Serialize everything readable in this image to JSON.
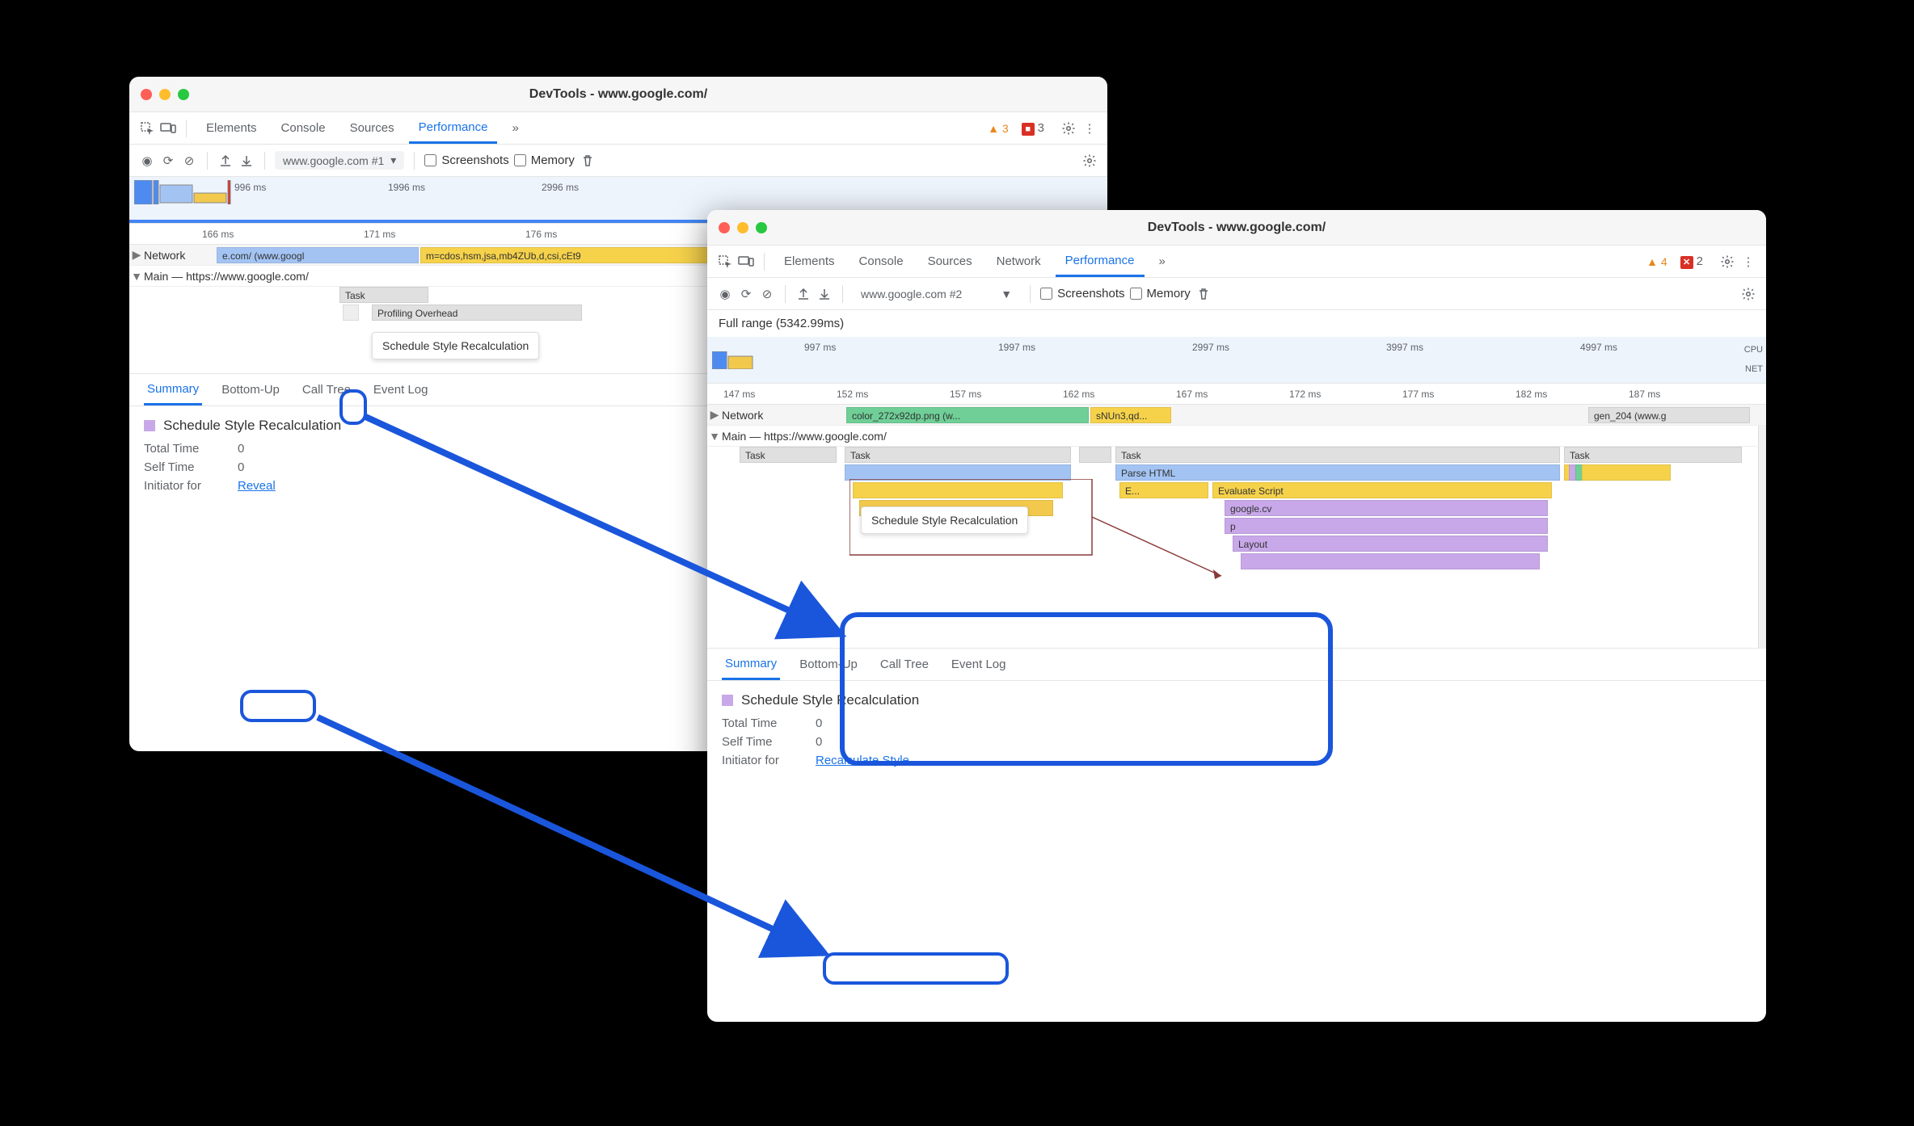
{
  "win1": {
    "title": "DevTools - www.google.com/",
    "tabs": {
      "elements": "Elements",
      "console": "Console",
      "sources": "Sources",
      "performance": "Performance",
      "more": "»"
    },
    "warn_count": "3",
    "err_count": "3",
    "toolbar": {
      "url": "www.google.com #1",
      "screenshots": "Screenshots",
      "memory": "Memory"
    },
    "timeline": {
      "t0": "996 ms",
      "t1": "1996 ms",
      "t2": "2996 ms"
    },
    "ruler": {
      "r0": "166 ms",
      "r1": "171 ms",
      "r2": "176 ms"
    },
    "network_label": "Network",
    "network_spans": {
      "a": "e.com/ (www.googl",
      "b": "m=cdos,hsm,jsa,mb4ZUb,d,csi,cEt9"
    },
    "main_label": "Main — https://www.google.com/",
    "flame": {
      "task": "Task",
      "profiling": "Profiling Overhead",
      "tip": "Schedule Style Recalculation"
    },
    "detail_tabs": {
      "summary": "Summary",
      "bottomup": "Bottom-Up",
      "calltree": "Call Tree",
      "eventlog": "Event Log"
    },
    "summary": {
      "title": "Schedule Style Recalculation",
      "total_k": "Total Time",
      "total_v": "0",
      "self_k": "Self Time",
      "self_v": "0",
      "init_k": "Initiator for",
      "init_link": "Reveal"
    }
  },
  "win2": {
    "title": "DevTools - www.google.com/",
    "tabs": {
      "elements": "Elements",
      "console": "Console",
      "sources": "Sources",
      "network": "Network",
      "performance": "Performance",
      "more": "»"
    },
    "warn_count": "4",
    "err_count": "2",
    "toolbar": {
      "url": "www.google.com #2",
      "screenshots": "Screenshots",
      "memory": "Memory"
    },
    "range": "Full range (5342.99ms)",
    "timeline": {
      "t0": "997 ms",
      "t1": "1997 ms",
      "t2": "2997 ms",
      "t3": "3997 ms",
      "t4": "4997 ms",
      "cpu": "CPU",
      "net": "NET"
    },
    "ruler": {
      "r0": "147 ms",
      "r1": "152 ms",
      "r2": "157 ms",
      "r3": "162 ms",
      "r4": "167 ms",
      "r5": "172 ms",
      "r6": "177 ms",
      "r7": "182 ms",
      "r8": "187 ms"
    },
    "network_label": "Network",
    "network_spans": {
      "a": "color_272x92dp.png (w...",
      "b": "sNUn3,qd...",
      "c": "gen_204 (www.g"
    },
    "main_label": "Main — https://www.google.com/",
    "flame": {
      "task": "Task",
      "parse": "Parse HTML",
      "e": "E...",
      "eval": "Evaluate Script",
      "googlecv": "google.cv",
      "p": "p",
      "layout": "Layout",
      "tip": "Schedule Style Recalculation"
    },
    "detail_tabs": {
      "summary": "Summary",
      "bottomup": "Bottom-Up",
      "calltree": "Call Tree",
      "eventlog": "Event Log"
    },
    "summary": {
      "title": "Schedule Style Recalculation",
      "total_k": "Total Time",
      "total_v": "0",
      "self_k": "Self Time",
      "self_v": "0",
      "init_k": "Initiator for",
      "init_link": "Recalculate Style"
    }
  }
}
